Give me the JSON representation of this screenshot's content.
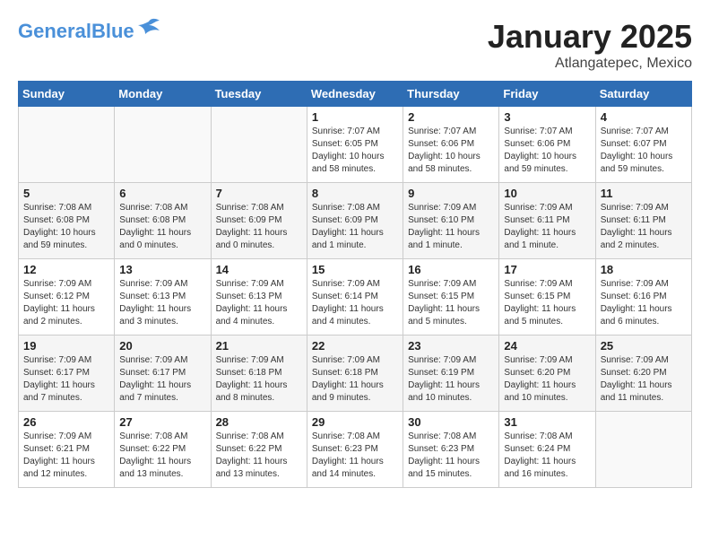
{
  "header": {
    "logo_line1": "General",
    "logo_line2": "Blue",
    "title": "January 2025",
    "subtitle": "Atlangatepec, Mexico"
  },
  "days_of_week": [
    "Sunday",
    "Monday",
    "Tuesday",
    "Wednesday",
    "Thursday",
    "Friday",
    "Saturday"
  ],
  "weeks": [
    [
      {
        "day": "",
        "info": ""
      },
      {
        "day": "",
        "info": ""
      },
      {
        "day": "",
        "info": ""
      },
      {
        "day": "1",
        "info": "Sunrise: 7:07 AM\nSunset: 6:05 PM\nDaylight: 10 hours\nand 58 minutes."
      },
      {
        "day": "2",
        "info": "Sunrise: 7:07 AM\nSunset: 6:06 PM\nDaylight: 10 hours\nand 58 minutes."
      },
      {
        "day": "3",
        "info": "Sunrise: 7:07 AM\nSunset: 6:06 PM\nDaylight: 10 hours\nand 59 minutes."
      },
      {
        "day": "4",
        "info": "Sunrise: 7:07 AM\nSunset: 6:07 PM\nDaylight: 10 hours\nand 59 minutes."
      }
    ],
    [
      {
        "day": "5",
        "info": "Sunrise: 7:08 AM\nSunset: 6:08 PM\nDaylight: 10 hours\nand 59 minutes."
      },
      {
        "day": "6",
        "info": "Sunrise: 7:08 AM\nSunset: 6:08 PM\nDaylight: 11 hours\nand 0 minutes."
      },
      {
        "day": "7",
        "info": "Sunrise: 7:08 AM\nSunset: 6:09 PM\nDaylight: 11 hours\nand 0 minutes."
      },
      {
        "day": "8",
        "info": "Sunrise: 7:08 AM\nSunset: 6:09 PM\nDaylight: 11 hours\nand 1 minute."
      },
      {
        "day": "9",
        "info": "Sunrise: 7:09 AM\nSunset: 6:10 PM\nDaylight: 11 hours\nand 1 minute."
      },
      {
        "day": "10",
        "info": "Sunrise: 7:09 AM\nSunset: 6:11 PM\nDaylight: 11 hours\nand 1 minute."
      },
      {
        "day": "11",
        "info": "Sunrise: 7:09 AM\nSunset: 6:11 PM\nDaylight: 11 hours\nand 2 minutes."
      }
    ],
    [
      {
        "day": "12",
        "info": "Sunrise: 7:09 AM\nSunset: 6:12 PM\nDaylight: 11 hours\nand 2 minutes."
      },
      {
        "day": "13",
        "info": "Sunrise: 7:09 AM\nSunset: 6:13 PM\nDaylight: 11 hours\nand 3 minutes."
      },
      {
        "day": "14",
        "info": "Sunrise: 7:09 AM\nSunset: 6:13 PM\nDaylight: 11 hours\nand 4 minutes."
      },
      {
        "day": "15",
        "info": "Sunrise: 7:09 AM\nSunset: 6:14 PM\nDaylight: 11 hours\nand 4 minutes."
      },
      {
        "day": "16",
        "info": "Sunrise: 7:09 AM\nSunset: 6:15 PM\nDaylight: 11 hours\nand 5 minutes."
      },
      {
        "day": "17",
        "info": "Sunrise: 7:09 AM\nSunset: 6:15 PM\nDaylight: 11 hours\nand 5 minutes."
      },
      {
        "day": "18",
        "info": "Sunrise: 7:09 AM\nSunset: 6:16 PM\nDaylight: 11 hours\nand 6 minutes."
      }
    ],
    [
      {
        "day": "19",
        "info": "Sunrise: 7:09 AM\nSunset: 6:17 PM\nDaylight: 11 hours\nand 7 minutes."
      },
      {
        "day": "20",
        "info": "Sunrise: 7:09 AM\nSunset: 6:17 PM\nDaylight: 11 hours\nand 7 minutes."
      },
      {
        "day": "21",
        "info": "Sunrise: 7:09 AM\nSunset: 6:18 PM\nDaylight: 11 hours\nand 8 minutes."
      },
      {
        "day": "22",
        "info": "Sunrise: 7:09 AM\nSunset: 6:18 PM\nDaylight: 11 hours\nand 9 minutes."
      },
      {
        "day": "23",
        "info": "Sunrise: 7:09 AM\nSunset: 6:19 PM\nDaylight: 11 hours\nand 10 minutes."
      },
      {
        "day": "24",
        "info": "Sunrise: 7:09 AM\nSunset: 6:20 PM\nDaylight: 11 hours\nand 10 minutes."
      },
      {
        "day": "25",
        "info": "Sunrise: 7:09 AM\nSunset: 6:20 PM\nDaylight: 11 hours\nand 11 minutes."
      }
    ],
    [
      {
        "day": "26",
        "info": "Sunrise: 7:09 AM\nSunset: 6:21 PM\nDaylight: 11 hours\nand 12 minutes."
      },
      {
        "day": "27",
        "info": "Sunrise: 7:08 AM\nSunset: 6:22 PM\nDaylight: 11 hours\nand 13 minutes."
      },
      {
        "day": "28",
        "info": "Sunrise: 7:08 AM\nSunset: 6:22 PM\nDaylight: 11 hours\nand 13 minutes."
      },
      {
        "day": "29",
        "info": "Sunrise: 7:08 AM\nSunset: 6:23 PM\nDaylight: 11 hours\nand 14 minutes."
      },
      {
        "day": "30",
        "info": "Sunrise: 7:08 AM\nSunset: 6:23 PM\nDaylight: 11 hours\nand 15 minutes."
      },
      {
        "day": "31",
        "info": "Sunrise: 7:08 AM\nSunset: 6:24 PM\nDaylight: 11 hours\nand 16 minutes."
      },
      {
        "day": "",
        "info": ""
      }
    ]
  ]
}
